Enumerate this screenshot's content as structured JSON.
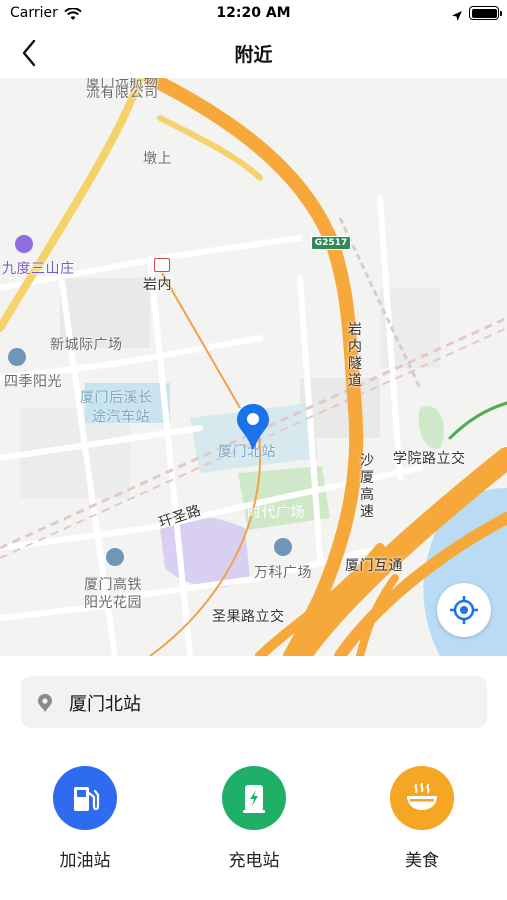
{
  "status_bar": {
    "carrier": "Carrier",
    "time": "12:20 AM"
  },
  "nav": {
    "title": "附近",
    "back_icon": "chevron-left-icon"
  },
  "map": {
    "labels": {
      "top_company_1": "厦门远航物",
      "top_company_2": "流有限公司",
      "dunshang": "墩上",
      "g2517": "G2517",
      "jiudu": "九度三山庄",
      "yannei": "岩内",
      "xinchengji": "新城际广场",
      "yannei_tunnel": "岩内隧道",
      "sijiyangguang": "四季阳光",
      "houxi_1": "厦门后溪长",
      "houxi_2": "途汽车站",
      "xiamen_north": "厦门北站",
      "xueyuan": "学院路立交",
      "shaxia": "沙厦高速",
      "shidai": "时代广场",
      "yisheng": "玕圣路",
      "wanke": "万科广场",
      "xiamen_hutong": "厦门互通",
      "gaotie_1": "厦门高铁",
      "gaotie_2": "阳光花园",
      "shengguo": "圣果路立交"
    },
    "locate_icon": "crosshair-icon",
    "pin_icon": "location-pin-icon"
  },
  "search": {
    "value": "厦门北站",
    "icon": "location-pin-icon"
  },
  "categories": [
    {
      "label": "加油站",
      "icon": "fuel-pump-icon",
      "color": "#2f6bf0"
    },
    {
      "label": "充电站",
      "icon": "charging-station-icon",
      "color": "#1fb068"
    },
    {
      "label": "美食",
      "icon": "food-bowl-icon",
      "color": "#f5a623"
    }
  ],
  "colors": {
    "highway": "#f6a83a",
    "water": "#b9dcf4",
    "park": "#cfe9c8",
    "accent": "#1a73e8"
  }
}
